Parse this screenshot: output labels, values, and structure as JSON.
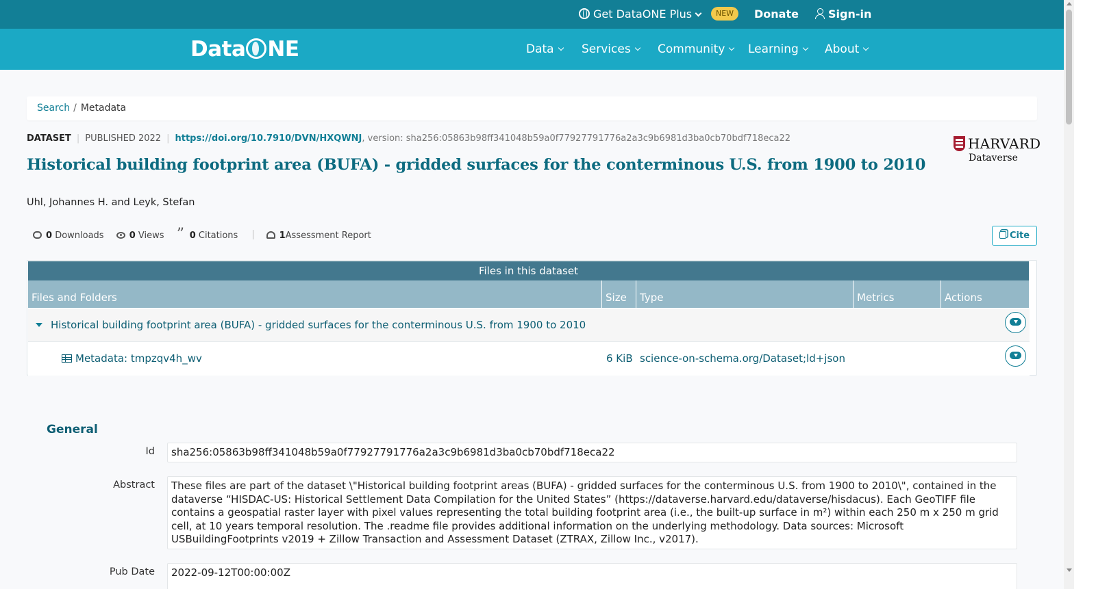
{
  "topbar": {
    "plus_label": "Get DataONE Plus",
    "new_badge": "NEW",
    "donate": "Donate",
    "signin": "Sign-in"
  },
  "nav": {
    "logo_left": "Data",
    "logo_right": "NE",
    "items": [
      "Data",
      "Services",
      "Community",
      "Learning",
      "About"
    ]
  },
  "breadcrumb": {
    "search": "Search",
    "sep": "/",
    "current": "Metadata"
  },
  "meta": {
    "type": "DATASET",
    "published": "PUBLISHED 2022",
    "doi": "https://doi.org/10.7910/DVN/HXQWNJ",
    "version_prefix": ", version: ",
    "version": "sha256:05863b98ff341048b59a0f77927791776a2a3c9b6981d3ba0cb70bdf718eca22"
  },
  "repository": {
    "name": "HARVARD",
    "sub": "Dataverse"
  },
  "title": "Historical building footprint area (BUFA) - gridded surfaces for the conterminous U.S. from 1900 to 2010",
  "authors": "Uhl, Johannes H. and Leyk, Stefan",
  "stats": {
    "downloads_count": "0",
    "downloads_label": "Downloads",
    "views_count": "0",
    "views_label": "Views",
    "citations_count": "0",
    "citations_label": "Citations",
    "assessment_count": "1",
    "assessment_label": "Assessment Report"
  },
  "cite_label": "Cite",
  "files": {
    "header": "Files in this dataset",
    "columns": [
      "Files and Folders",
      "Size",
      "Type",
      "Metrics",
      "Actions"
    ],
    "package": "Historical building footprint area (BUFA) - gridded surfaces for the conterminous U.S. from 1900 to 2010",
    "rows": [
      {
        "name": "Metadata: tmpzqv4h_wv",
        "size": "6 KiB",
        "type": "science-on-schema.org/Dataset;ld+json"
      }
    ]
  },
  "general": {
    "heading": "General",
    "id_label": "Id",
    "id_value": "sha256:05863b98ff341048b59a0f77927791776a2a3c9b6981d3ba0cb70bdf718eca22",
    "abstract_label": "Abstract",
    "abstract_value": "These files are part of the dataset \\\"Historical building footprint areas (BUFA) - gridded surfaces for the conterminous U.S. from 1900 to 2010\\\", contained in the dataverse “HISDAC-US: Historical Settlement Data Compilation for the United States” (https://dataverse.harvard.edu/dataverse/hisdacus). Each GeoTIFF file contains a geospatial raster layer with pixel values representing the total building footprint area (i.e., the built-up surface in m²) within each 250 m x 250 m grid cell, at 10 years temporal resolution. The .readme file provides additional information on the underlying methodology. Data sources: Microsoft USBuildingFootprints v2019 + Zillow Transaction and Assessment Dataset (ZTRAX, Zillow Inc., v2017).",
    "pubdate_label": "Pub Date",
    "pubdate_value": "2022-09-12T00:00:00Z"
  },
  "colors": {
    "topbar": "#127f96",
    "navbar": "#1ba9c5",
    "accent": "#127f96",
    "table_header": "#43788e",
    "column_header": "#94b8c7"
  }
}
